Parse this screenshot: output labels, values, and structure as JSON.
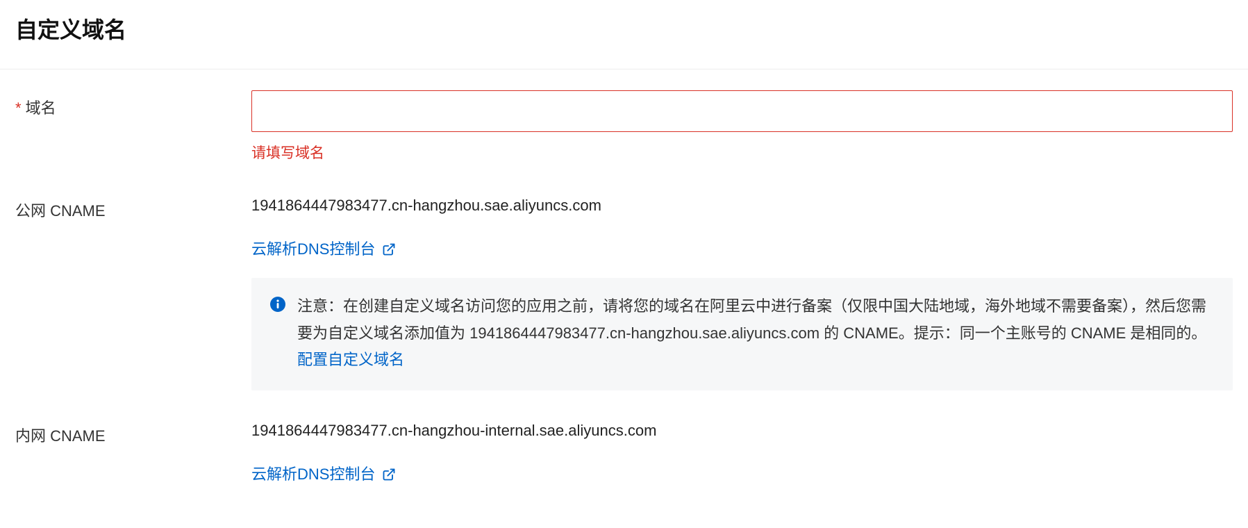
{
  "page": {
    "title": "自定义域名"
  },
  "form": {
    "domain": {
      "label": "域名",
      "value": "",
      "error": "请填写域名"
    },
    "public_cname": {
      "label": "公网 CNAME",
      "value": "1941864447983477.cn-hangzhou.sae.aliyuncs.com",
      "dns_link": "云解析DNS控制台",
      "notice_text": "注意：在创建自定义域名访问您的应用之前，请将您的域名在阿里云中进行备案（仅限中国大陆地域，海外地域不需要备案），然后您需要为自定义域名添加值为 1941864447983477.cn-hangzhou.sae.aliyuncs.com 的 CNAME。提示：同一个主账号的 CNAME 是相同的。",
      "notice_link_text": "配置自定义域名"
    },
    "internal_cname": {
      "label": "内网 CNAME",
      "value": "1941864447983477.cn-hangzhou-internal.sae.aliyuncs.com",
      "dns_link": "云解析DNS控制台"
    }
  }
}
